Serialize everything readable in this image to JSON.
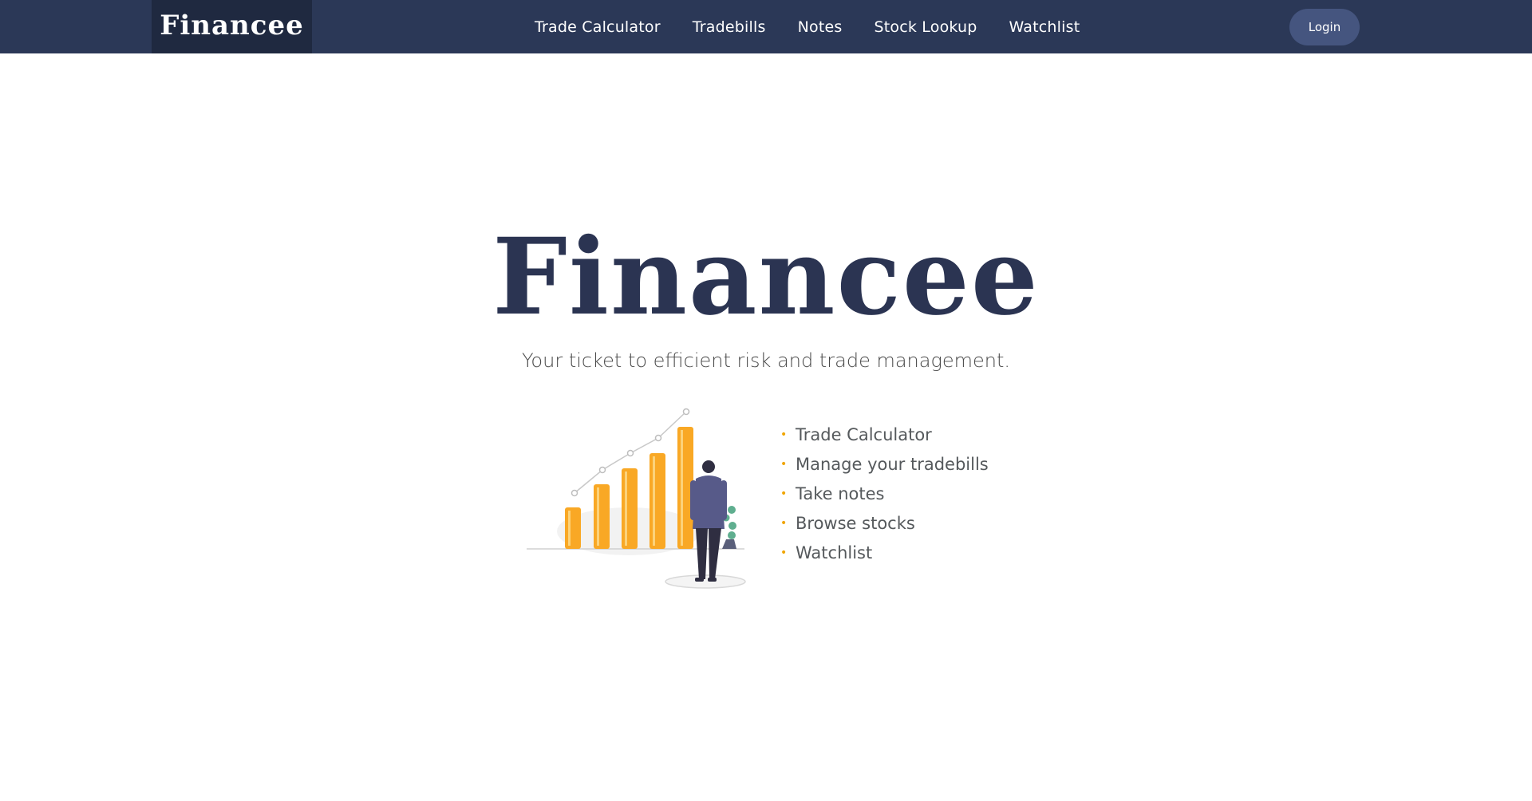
{
  "navbar": {
    "brand": "Financee",
    "links": [
      "Trade Calculator",
      "Tradebills",
      "Notes",
      "Stock Lookup",
      "Watchlist"
    ],
    "login_label": "Login"
  },
  "hero": {
    "title": "Financee",
    "subtitle": "Your ticket to efficient risk and trade management.",
    "features": [
      "Trade Calculator",
      "Manage your tradebills",
      "Take notes",
      "Browse stocks",
      "Watchlist"
    ],
    "bullet": "•"
  },
  "colors": {
    "navbar_bg": "#2b3857",
    "brand_bg": "#1f2940",
    "login_bg": "#45557f",
    "title": "#2b3452",
    "bar_accent": "#f9a825",
    "bullet_accent": "#f0a500"
  },
  "icons": {
    "illustration": "growth-chart-person-illustration"
  }
}
